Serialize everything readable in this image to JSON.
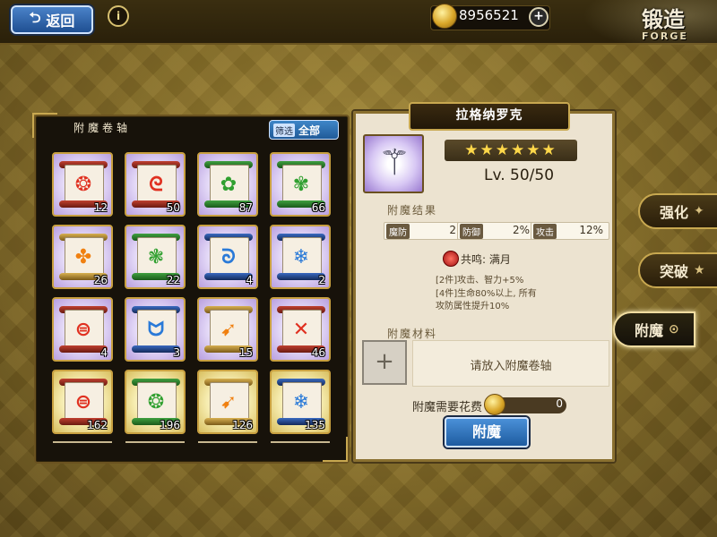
{
  "header": {
    "back_label": "返回",
    "info_symbol": "i",
    "gold_amount": "8956521",
    "plus_symbol": "+",
    "forge_title": "锻造",
    "forge_subtitle": "FORGE"
  },
  "scroll_panel": {
    "title": "附魔卷轴",
    "filter_small": "筛选",
    "filter_label": "全部",
    "items": [
      {
        "rune": "❂",
        "color": "red",
        "bg": "purple",
        "count": "12"
      },
      {
        "rune": "ᘓ",
        "color": "red",
        "bg": "purple",
        "count": "50"
      },
      {
        "rune": "✿",
        "color": "green",
        "bg": "purple",
        "count": "87"
      },
      {
        "rune": "✾",
        "color": "green",
        "bg": "purple",
        "count": "66"
      },
      {
        "rune": "✤",
        "color": "orange",
        "bg": "purple",
        "count": "26"
      },
      {
        "rune": "❃",
        "color": "green",
        "bg": "purple",
        "count": "22"
      },
      {
        "rune": "ᘐ",
        "color": "blue",
        "bg": "purple",
        "count": "4"
      },
      {
        "rune": "❄",
        "color": "blue",
        "bg": "purple",
        "count": "2"
      },
      {
        "rune": "⊜",
        "color": "red",
        "bg": "purple",
        "count": "4"
      },
      {
        "rune": "ᗢ",
        "color": "blue",
        "bg": "purple",
        "count": "3"
      },
      {
        "rune": "➹",
        "color": "orange",
        "bg": "purple",
        "count": "15"
      },
      {
        "rune": "✕",
        "color": "red",
        "bg": "purple",
        "count": "46"
      },
      {
        "rune": "⊜",
        "color": "red",
        "bg": "yellow",
        "count": "162"
      },
      {
        "rune": "❂",
        "color": "green",
        "bg": "yellow",
        "count": "196"
      },
      {
        "rune": "➹",
        "color": "orange",
        "bg": "yellow",
        "count": "126"
      },
      {
        "rune": "❄",
        "color": "blue",
        "bg": "yellow",
        "count": "135"
      }
    ]
  },
  "detail": {
    "weapon_name": "拉格纳罗克",
    "weapon_icon": "⚚",
    "stars": "★★★★★★",
    "level": "Lv. 50/50",
    "result_title": "附魔结果",
    "stats": [
      {
        "label": "魔防",
        "value": "2"
      },
      {
        "label": "防御",
        "value": "2%"
      },
      {
        "label": "攻击",
        "value": "12%"
      }
    ],
    "resonance": "共鸣: 满月",
    "effects": [
      "[2件]攻击、智力+5%",
      "[4件]生命80%以上, 所有",
      "攻防属性提升10%"
    ],
    "material_title": "附魔材料",
    "slot_plus": "+",
    "slot_hint": "请放入附魔卷轴",
    "cost_label": "附魔需要花费",
    "cost_value": "0",
    "enchant_button": "附魔"
  },
  "side_tabs": [
    {
      "label": "强化",
      "icon": "✦"
    },
    {
      "label": "突破",
      "icon": "★"
    },
    {
      "label": "附魔",
      "icon": "⊙"
    }
  ]
}
